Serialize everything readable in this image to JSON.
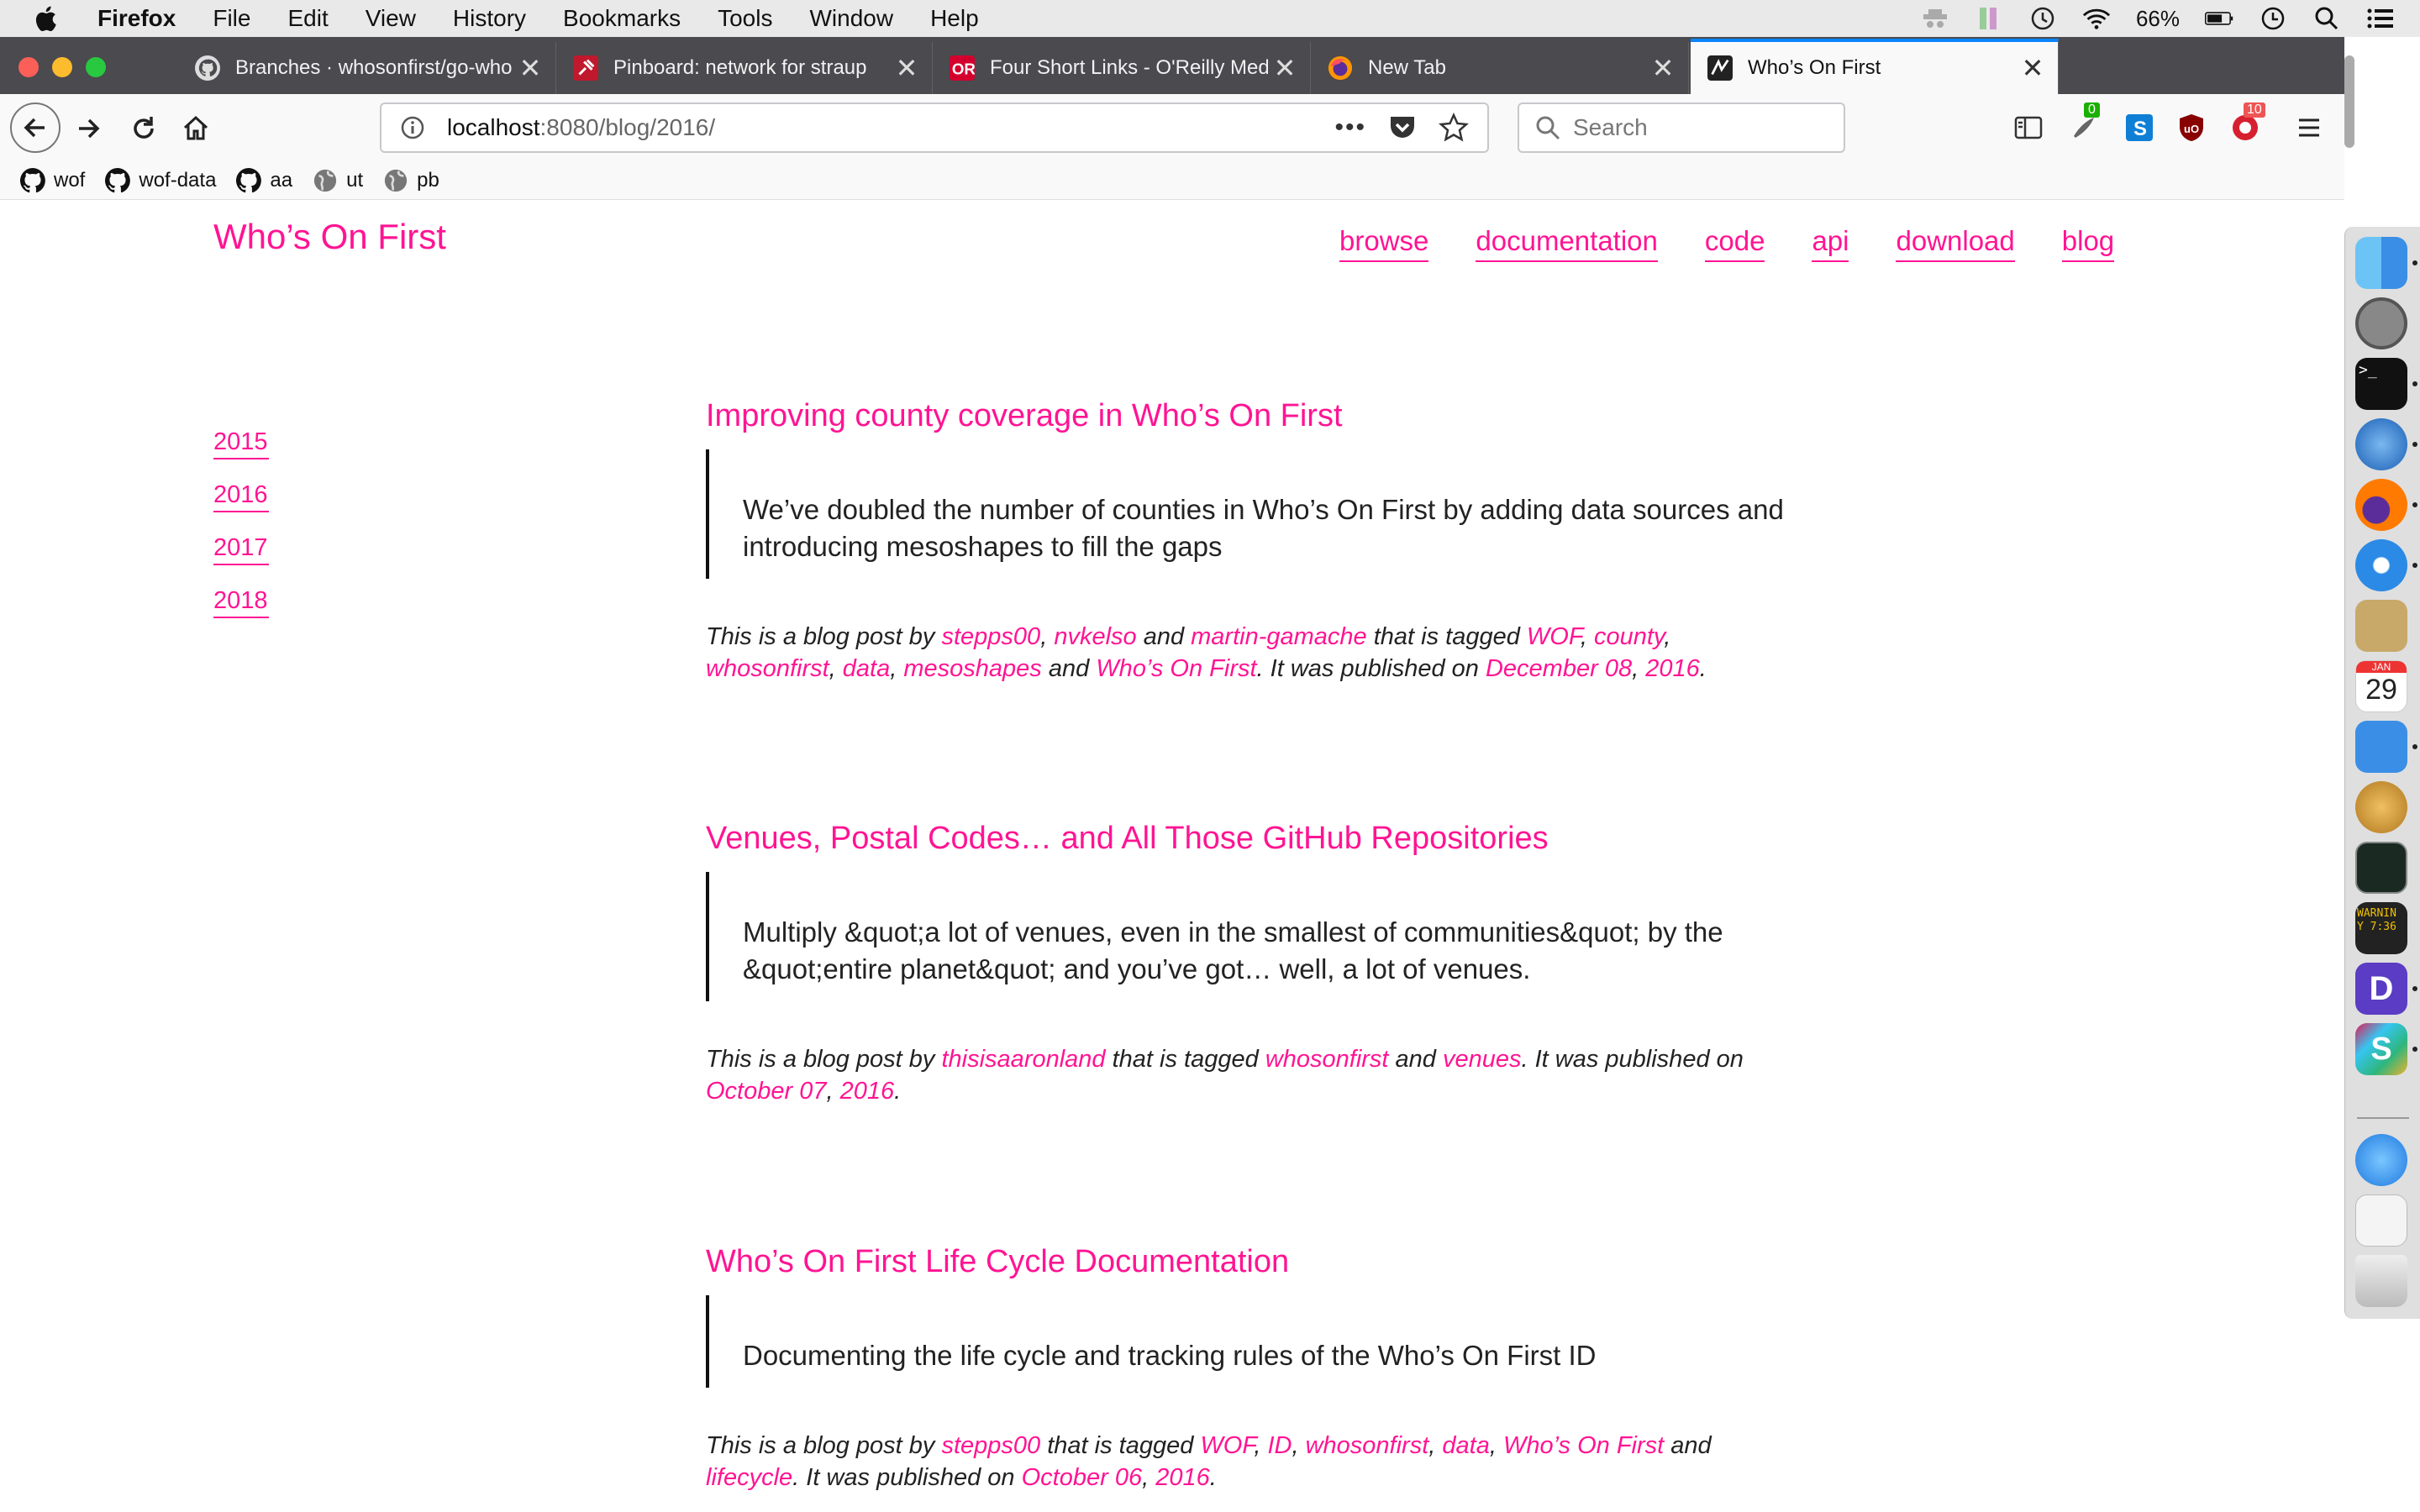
{
  "menubar": {
    "app": "Firefox",
    "items": [
      "File",
      "Edit",
      "View",
      "History",
      "Bookmarks",
      "Tools",
      "Window",
      "Help"
    ],
    "battery": "66%"
  },
  "tabs": [
    {
      "label": "Branches · whosonfirst/go-who",
      "favicon": "github-icon",
      "active": false
    },
    {
      "label": "Pinboard: network for straup",
      "favicon": "pinboard-icon",
      "active": false
    },
    {
      "label": "Four Short Links - O'Reilly Med",
      "favicon": "oreilly-icon",
      "active": false
    },
    {
      "label": "New Tab",
      "favicon": "firefox-icon",
      "active": false
    },
    {
      "label": "Who’s On First",
      "favicon": "wof-icon",
      "active": true
    }
  ],
  "urlbar": {
    "host": "localhost",
    "path": ":8080/blog/2016/"
  },
  "search": {
    "placeholder": "Search"
  },
  "extensions": {
    "badge1": "0",
    "badge2": "10"
  },
  "bookmarks": [
    {
      "label": "wof",
      "icon": "github-icon"
    },
    {
      "label": "wof-data",
      "icon": "github-icon"
    },
    {
      "label": "aa",
      "icon": "github-icon"
    },
    {
      "label": "ut",
      "icon": "globe-icon"
    },
    {
      "label": "pb",
      "icon": "globe-icon"
    }
  ],
  "site": {
    "title": "Who’s On First",
    "nav": [
      "browse",
      "documentation",
      "code",
      "api",
      "download",
      "blog"
    ],
    "years": [
      "2015",
      "2016",
      "2017",
      "2018"
    ]
  },
  "posts": [
    {
      "title": "Improving county coverage in Who’s On First",
      "excerpt": "We’ve doubled the number of counties in Who’s On First by adding data sources and introducing mesoshapes to fill the gaps",
      "meta_html": "This is a blog post by <a>stepps00</a>, <a>nvkelso</a> and <a>martin-gamache</a> that is tagged <a>WOF</a>, <a>county</a>, <a>whosonfirst</a>, <a>data</a>, <a>mesoshapes</a> and <a>Who’s On First</a>. It was published on <a>December 08</a>, <a>2016</a>."
    },
    {
      "title": "Venues, Postal Codes… and All Those GitHub Repositories",
      "excerpt": "Multiply &quot;a lot of venues, even in the smallest of communities&quot; by the &quot;entire planet&quot; and you’ve got… well, a lot of venues.",
      "meta_html": "This is a blog post by <a>thisisaaronland</a> that is tagged <a>whosonfirst</a> and <a>venues</a>. It was published on <a>October 07</a>, <a>2016</a>."
    },
    {
      "title": "Who’s On First Life Cycle Documentation",
      "excerpt": "Documenting the life cycle and tracking rules of the Who’s On First ID",
      "meta_html": "This is a blog post by <a>stepps00</a> that is tagged <a>WOF</a>, <a>ID</a>, <a>whosonfirst</a>, <a>data</a>, <a>Who’s On First</a> and <a>lifecycle</a>. It was published on <a>October 06</a>, <a>2016</a>."
    }
  ],
  "dock": {
    "calendar_month": "JAN",
    "calendar_day": "29",
    "console_text": "WARNIN",
    "console_sub": "Y 7:36"
  },
  "colors": {
    "accent": "#ff1493",
    "tab_active_border": "#0a84ff"
  }
}
